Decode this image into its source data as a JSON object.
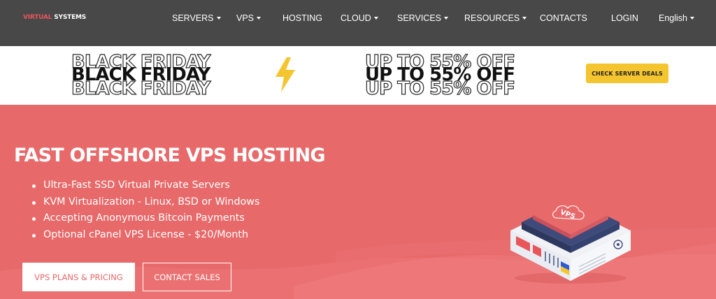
{
  "brand": {
    "logo_part1": "VIRTUAL",
    "logo_part2": " SYSTEMS"
  },
  "nav": {
    "items": [
      {
        "label": "SERVERS",
        "dropdown": true
      },
      {
        "label": "VPS",
        "dropdown": true
      },
      {
        "label": "HOSTING",
        "dropdown": false
      },
      {
        "label": "CLOUD",
        "dropdown": true
      },
      {
        "label": "SERVICES",
        "dropdown": true
      },
      {
        "label": "RESOURCES",
        "dropdown": true
      },
      {
        "label": "CONTACTS",
        "dropdown": false
      }
    ],
    "login": "LOGIN",
    "language": "English"
  },
  "promo": {
    "title": "BLACK FRIDAY",
    "offer": "UP TO 55% OFF",
    "cta": "CHECK SERVER DEALS",
    "icon": "lightning-bolt-icon"
  },
  "hero": {
    "title": "FAST OFFSHORE VPS HOSTING",
    "features": [
      "Ultra-Fast SSD Virtual Private Servers",
      "KVM Virtualization - Linux, BSD or Windows",
      "Accepting Anonymous Bitcoin Payments",
      "Optional cPanel VPS License - $20/Month"
    ],
    "primary_cta": "VPS PLANS & PRICING",
    "secondary_cta": "CONTACT SALES",
    "illustration_label": "VPS"
  },
  "colors": {
    "nav_bg": "#484848",
    "hero_bg": "#e8696a",
    "accent_yellow": "#f5c52f",
    "logo_red": "#e8555a",
    "server_navy": "#3d4a7a"
  }
}
